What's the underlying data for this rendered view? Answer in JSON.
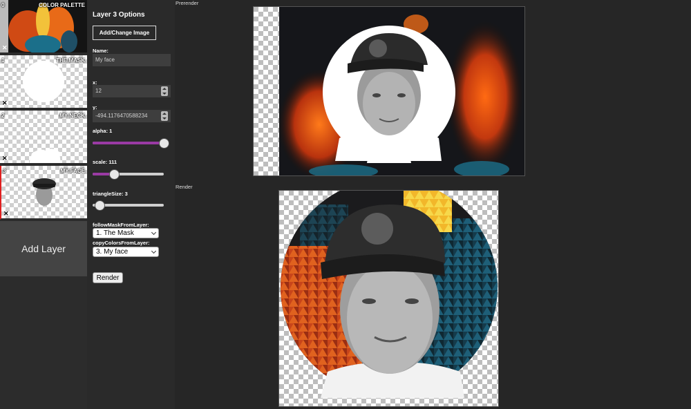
{
  "layers": [
    {
      "index": "0",
      "title": "COLOR PALETTE",
      "delete": "✕"
    },
    {
      "index": "1",
      "title": "THE MASK",
      "delete": "✕"
    },
    {
      "index": "2",
      "title": "MY NECK",
      "delete": "✕"
    },
    {
      "index": "3",
      "title": "MY FACE",
      "delete": "✕"
    }
  ],
  "add_layer_label": "Add Layer",
  "options": {
    "title": "Layer 3 Options",
    "add_change_image": "Add/Change Image",
    "name_label": "Name:",
    "name_value": "My face",
    "x_label": "x:",
    "x_value": "12",
    "y_label": "y:",
    "y_value": "-494.1176470588234",
    "alpha_label": "alpha: 1",
    "alpha_level": 1.0,
    "scale_label": "scale: 111",
    "scale_level": 0.3,
    "triangle_label": "triangleSize: 3",
    "triangle_level": 0.1,
    "follow_label": "followMaskFromLayer:",
    "follow_value": "1. The Mask",
    "copy_label": "copyColorsFromLayer:",
    "copy_value": "3. My face",
    "render_button": "Render"
  },
  "canvas": {
    "prerender_label": "Prerender",
    "render_label": "Render"
  },
  "colors": {
    "accent": "#9a3aa4",
    "selected_layer_border": "#e02020",
    "fire_orange": "#e8561a",
    "teal": "#1b6f8a"
  }
}
